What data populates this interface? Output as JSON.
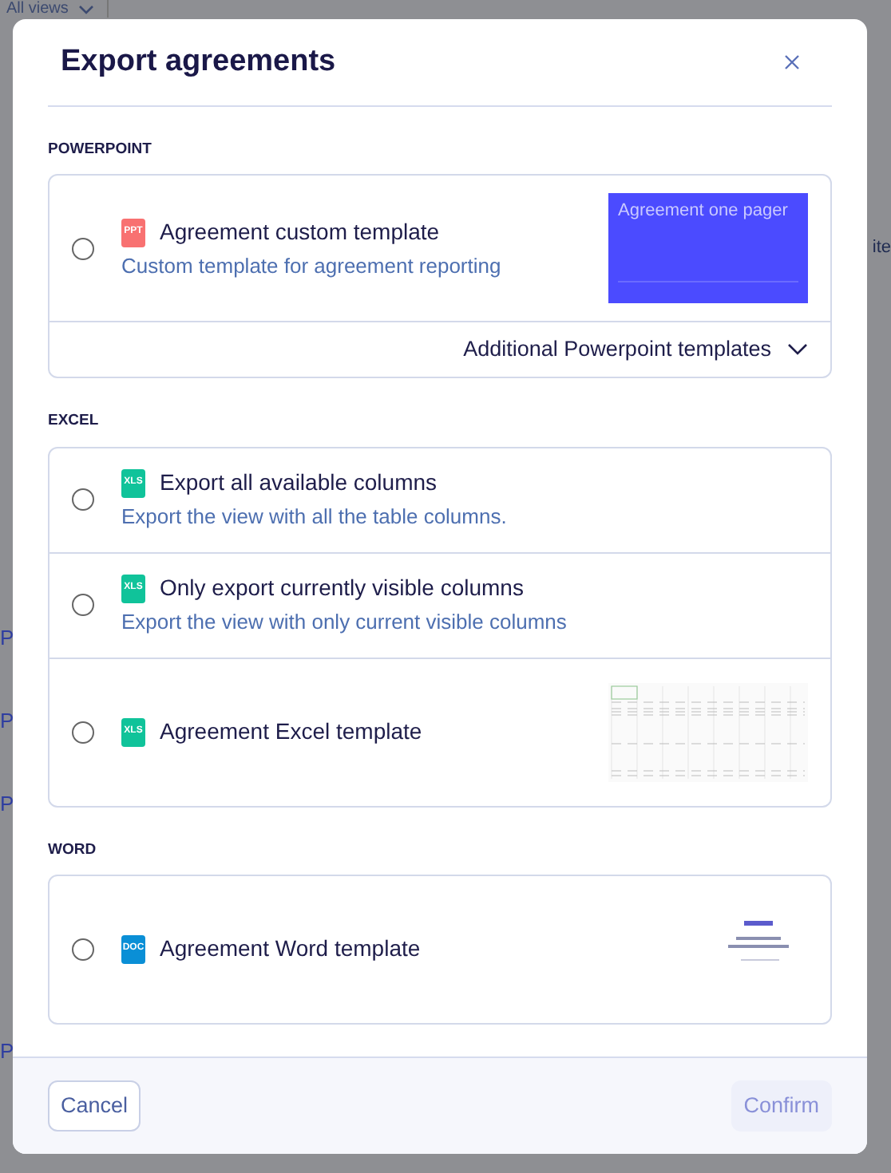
{
  "background": {
    "view_selector": "All views",
    "column_fragment": "ite",
    "row_links": [
      "P",
      "P",
      "P",
      "P"
    ]
  },
  "dialog": {
    "title": "Export agreements",
    "sections": [
      {
        "label": "POWERPOINT",
        "options": [
          {
            "kind": "ppt",
            "badge": "PPT",
            "title": "Agreement custom template",
            "description": "Custom template for agreement reporting",
            "selected": false,
            "preview": {
              "kind": "slide",
              "caption": "Agreement one pager"
            }
          }
        ],
        "more": {
          "label": "Additional Powerpoint templates",
          "expanded": false
        }
      },
      {
        "label": "EXCEL",
        "options": [
          {
            "kind": "xls",
            "badge": "XLS",
            "title": "Export all available columns",
            "description": "Export the view with all the table columns.",
            "selected": false
          },
          {
            "kind": "xls",
            "badge": "XLS",
            "title": "Only export currently visible columns",
            "description": "Export the view with only current visible columns",
            "selected": false
          },
          {
            "kind": "xls",
            "badge": "XLS",
            "title": "Agreement Excel template",
            "selected": false,
            "preview": {
              "kind": "sheet"
            }
          }
        ]
      },
      {
        "label": "WORD",
        "options": [
          {
            "kind": "doc",
            "badge": "DOC",
            "title": "Agreement Word template",
            "selected": false,
            "preview": {
              "kind": "document"
            }
          }
        ]
      }
    ],
    "footer": {
      "cancel": "Cancel",
      "confirm": "Confirm",
      "confirm_disabled": true
    }
  }
}
